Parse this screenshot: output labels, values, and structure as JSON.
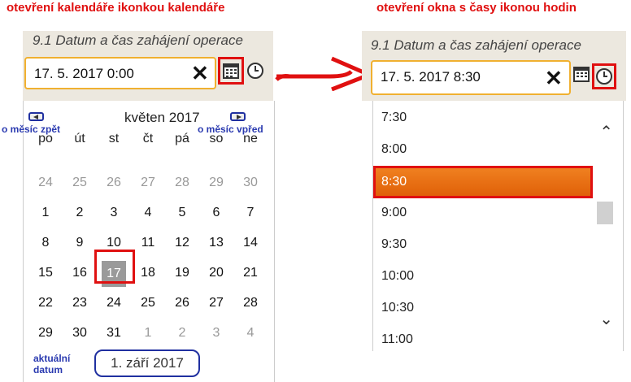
{
  "captions": {
    "left": "otevření kalendáře ikonkou kalendáře",
    "right": "otevření okna s časy ikonou hodin"
  },
  "field_label": "9.1 Datum a čas zahájení operace",
  "left_input": {
    "value": "17. 5. 2017 0:00",
    "clear": "✕"
  },
  "right_input": {
    "value": "17. 5. 2017 8:30",
    "clear": "✕"
  },
  "calendar": {
    "month": "květen 2017",
    "notes": {
      "prev": "o měsíc zpět",
      "next": "o měsíc vpřed",
      "today": "aktuální datum"
    },
    "weekdays": [
      "po",
      "út",
      "st",
      "čt",
      "pá",
      "so",
      "ne"
    ],
    "weeks": [
      [
        "24",
        "25",
        "26",
        "27",
        "28",
        "29",
        "30"
      ],
      [
        "1",
        "2",
        "3",
        "4",
        "5",
        "6",
        "7"
      ],
      [
        "8",
        "9",
        "10",
        "11",
        "12",
        "13",
        "14"
      ],
      [
        "15",
        "16",
        "17",
        "18",
        "19",
        "20",
        "21"
      ],
      [
        "22",
        "23",
        "24",
        "25",
        "26",
        "27",
        "28"
      ],
      [
        "29",
        "30",
        "31",
        "1",
        "2",
        "3",
        "4"
      ]
    ],
    "selected": "17",
    "today_button": "1. září 2017"
  },
  "times": [
    "7:30",
    "8:00",
    "8:30",
    "9:00",
    "9:30",
    "10:00",
    "10:30",
    "11:00"
  ],
  "selected_time": "8:30",
  "colors": {
    "caption": "#e01010",
    "note": "#2a3ab0",
    "accent": "#f08020",
    "frame": "#e01010"
  }
}
